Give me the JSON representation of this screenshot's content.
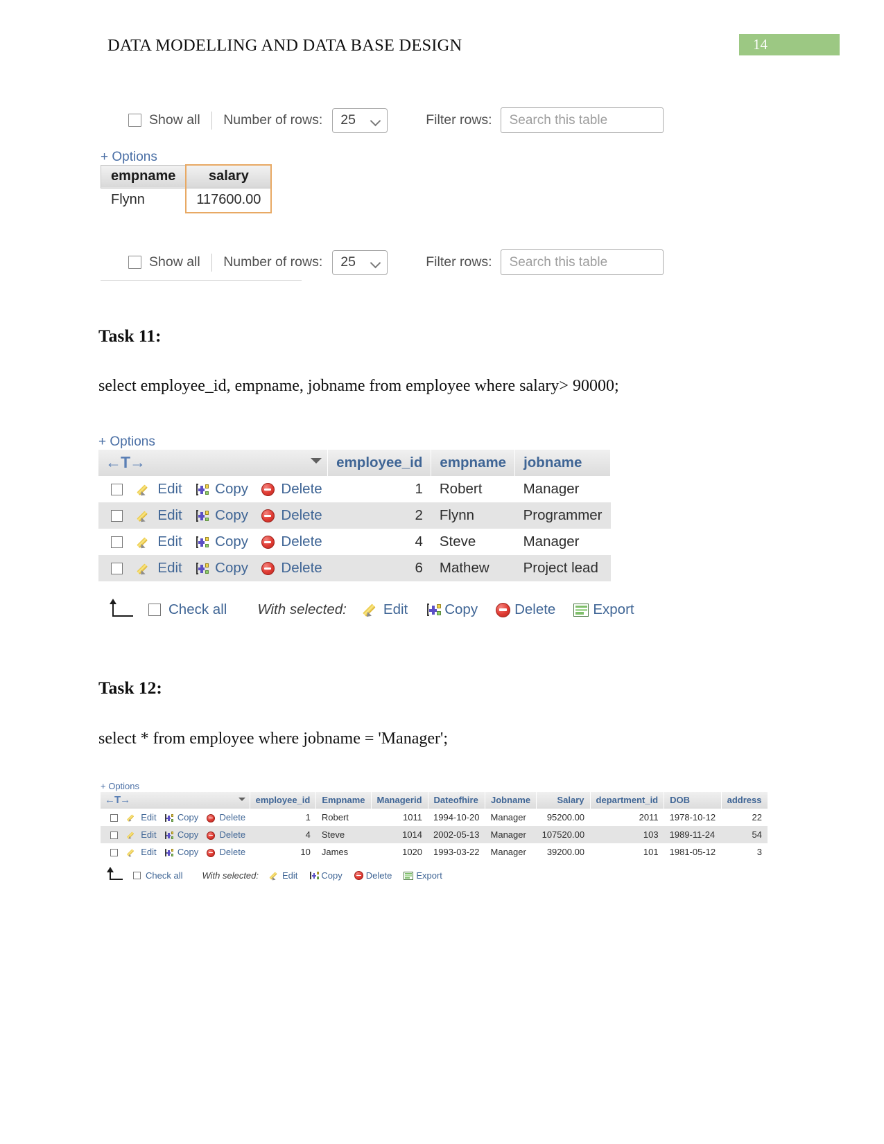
{
  "document": {
    "header_title": "DATA MODELLING AND DATA BASE DESIGN",
    "page_number": "14"
  },
  "icons": {
    "edit": "pencil-icon",
    "copy": "copy-icon",
    "delete": "delete-icon",
    "export": "export-icon",
    "sort": "chevron-down-icon",
    "nav": "column-move-icon",
    "up": "arrow-up-icon"
  },
  "colors": {
    "page_badge": "#9cc883",
    "link": "#3f6595",
    "header_text": "#3f6595",
    "row_stripe": "#e4e4e4",
    "highlight_border": "#e8a964"
  },
  "controls_top": {
    "show_all_label": "Show all",
    "number_of_rows_label": "Number of rows:",
    "rows_value": "25",
    "filter_label": "Filter rows:",
    "search_placeholder": "Search this table"
  },
  "controls_bottom": {
    "show_all_label": "Show all",
    "number_of_rows_label": "Number of rows:",
    "rows_value": "25",
    "filter_label": "Filter rows:",
    "search_placeholder": "Search this table"
  },
  "result_salary": {
    "options_label": "+ Options",
    "columns": [
      "empname",
      "salary"
    ],
    "rows": [
      {
        "empname": "Flynn",
        "salary": "117600.00"
      }
    ]
  },
  "task11": {
    "heading": "Task 11:",
    "sql": "select employee_id, empname, jobname from employee where salary> 90000;",
    "options_label": "+ Options",
    "nav_label": "←T→",
    "columns": [
      "employee_id",
      "empname",
      "jobname"
    ],
    "row_actions": {
      "edit": "Edit",
      "copy": "Copy",
      "delete": "Delete"
    },
    "rows": [
      {
        "employee_id": "1",
        "empname": "Robert",
        "jobname": "Manager"
      },
      {
        "employee_id": "2",
        "empname": "Flynn",
        "jobname": "Programmer"
      },
      {
        "employee_id": "4",
        "empname": "Steve",
        "jobname": "Manager"
      },
      {
        "employee_id": "6",
        "empname": "Mathew",
        "jobname": "Project lead"
      }
    ],
    "footer": {
      "check_all": "Check all",
      "with_selected": "With selected:",
      "edit": "Edit",
      "copy": "Copy",
      "delete": "Delete",
      "export": "Export"
    }
  },
  "task12": {
    "heading": "Task 12:",
    "sql": "select * from employee where jobname = 'Manager';",
    "options_label": "+ Options",
    "nav_label": "←T→",
    "columns": [
      "employee_id",
      "Empname",
      "Managerid",
      "Dateofhire",
      "Jobname",
      "Salary",
      "department_id",
      "DOB",
      "address"
    ],
    "row_actions": {
      "edit": "Edit",
      "copy": "Copy",
      "delete": "Delete"
    },
    "rows": [
      {
        "employee_id": "1",
        "Empname": "Robert",
        "Managerid": "1011",
        "Dateofhire": "1994-10-20",
        "Jobname": "Manager",
        "Salary": "95200.00",
        "department_id": "2011",
        "DOB": "1978-10-12",
        "address": "22"
      },
      {
        "employee_id": "4",
        "Empname": "Steve",
        "Managerid": "1014",
        "Dateofhire": "2002-05-13",
        "Jobname": "Manager",
        "Salary": "107520.00",
        "department_id": "103",
        "DOB": "1989-11-24",
        "address": "54"
      },
      {
        "employee_id": "10",
        "Empname": "James",
        "Managerid": "1020",
        "Dateofhire": "1993-03-22",
        "Jobname": "Manager",
        "Salary": "39200.00",
        "department_id": "101",
        "DOB": "1981-05-12",
        "address": "3"
      }
    ],
    "footer": {
      "check_all": "Check all",
      "with_selected": "With selected:",
      "edit": "Edit",
      "copy": "Copy",
      "delete": "Delete",
      "export": "Export"
    }
  }
}
